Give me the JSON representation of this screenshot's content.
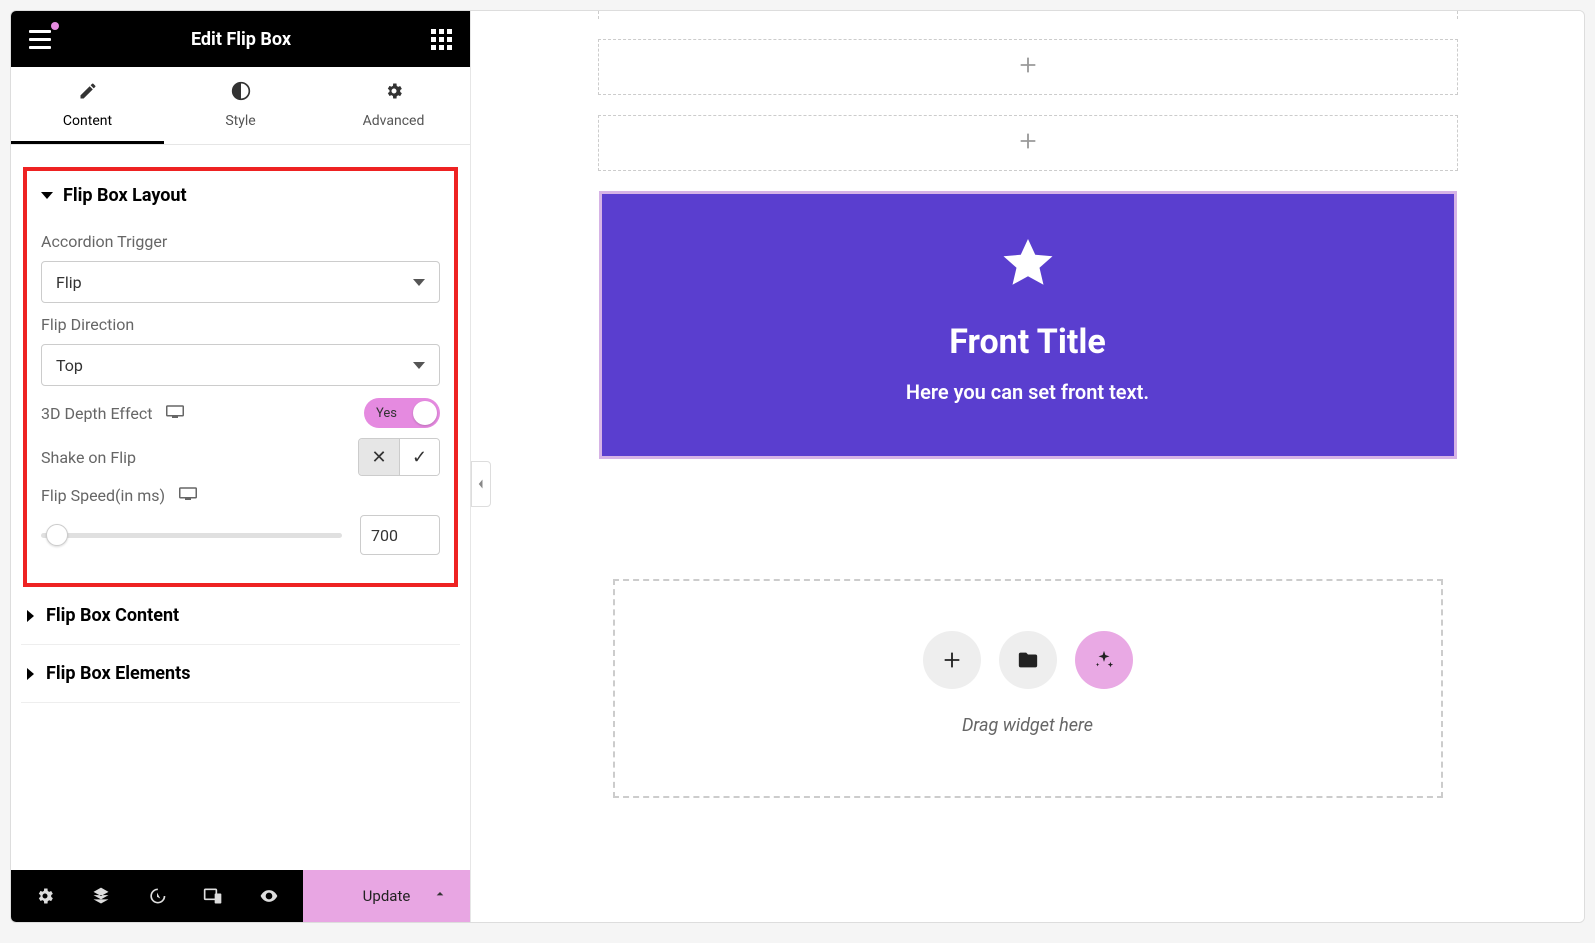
{
  "header": {
    "title": "Edit Flip Box"
  },
  "tabs": {
    "content": "Content",
    "style": "Style",
    "advanced": "Advanced",
    "active": "content"
  },
  "sections": {
    "layout": {
      "title": "Flip Box Layout",
      "accordion_trigger_label": "Accordion Trigger",
      "accordion_trigger_value": "Flip",
      "flip_direction_label": "Flip Direction",
      "flip_direction_value": "Top",
      "depth_label": "3D Depth Effect",
      "depth_value": "Yes",
      "shake_label": "Shake on Flip",
      "speed_label": "Flip Speed(in ms)",
      "speed_value": "700"
    },
    "content_title": "Flip Box Content",
    "elements_title": "Flip Box Elements"
  },
  "bottom": {
    "update": "Update"
  },
  "canvas": {
    "flipbox": {
      "title": "Front Title",
      "text": "Here you can set front text."
    },
    "drop_text": "Drag widget here"
  }
}
